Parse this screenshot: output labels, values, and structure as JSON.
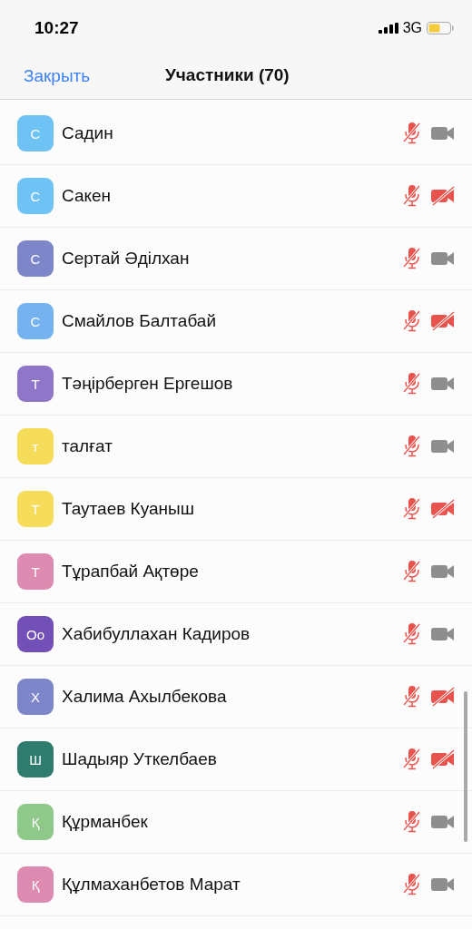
{
  "status_bar": {
    "time": "10:27",
    "network": "3G"
  },
  "nav": {
    "close": "Закрыть",
    "title": "Участники (70)"
  },
  "participants": [
    {
      "initials": "С",
      "name": "Садин",
      "color": "#6ec3f4",
      "mic_muted": true,
      "video_muted": false
    },
    {
      "initials": "С",
      "name": "Сакен",
      "color": "#6ec3f4",
      "mic_muted": true,
      "video_muted": true
    },
    {
      "initials": "С",
      "name": "Сертай Әділхан",
      "color": "#7d86c8",
      "mic_muted": true,
      "video_muted": false
    },
    {
      "initials": "С",
      "name": "Смайлов Балтабай",
      "color": "#74b2f0",
      "mic_muted": true,
      "video_muted": true
    },
    {
      "initials": "Т",
      "name": "Тәңірберген Ергешов",
      "color": "#9076c9",
      "mic_muted": true,
      "video_muted": false
    },
    {
      "initials": "т",
      "name": "талғат",
      "color": "#f5dc5a",
      "mic_muted": true,
      "video_muted": false
    },
    {
      "initials": "Т",
      "name": "Таутаев Куаныш",
      "color": "#f5dc5a",
      "mic_muted": true,
      "video_muted": true
    },
    {
      "initials": "Т",
      "name": "Тұрапбай Ақтөре",
      "color": "#dd8bb0",
      "mic_muted": true,
      "video_muted": false
    },
    {
      "initials": "Оо",
      "name": "Хабибуллахан Кадиров",
      "color": "#7350b8",
      "mic_muted": true,
      "video_muted": false
    },
    {
      "initials": "Х",
      "name": "Халима Ахылбекова",
      "color": "#7d86c8",
      "mic_muted": true,
      "video_muted": true
    },
    {
      "initials": "Ш",
      "name": "Шадыяр Уткелбаев",
      "color": "#2f7b6e",
      "mic_muted": true,
      "video_muted": true
    },
    {
      "initials": "Қ",
      "name": "Құрманбек",
      "color": "#8fc98a",
      "mic_muted": true,
      "video_muted": false
    },
    {
      "initials": "Қ",
      "name": "Құлмаханбетов Марат",
      "color": "#dd8bb0",
      "mic_muted": true,
      "video_muted": false
    }
  ]
}
